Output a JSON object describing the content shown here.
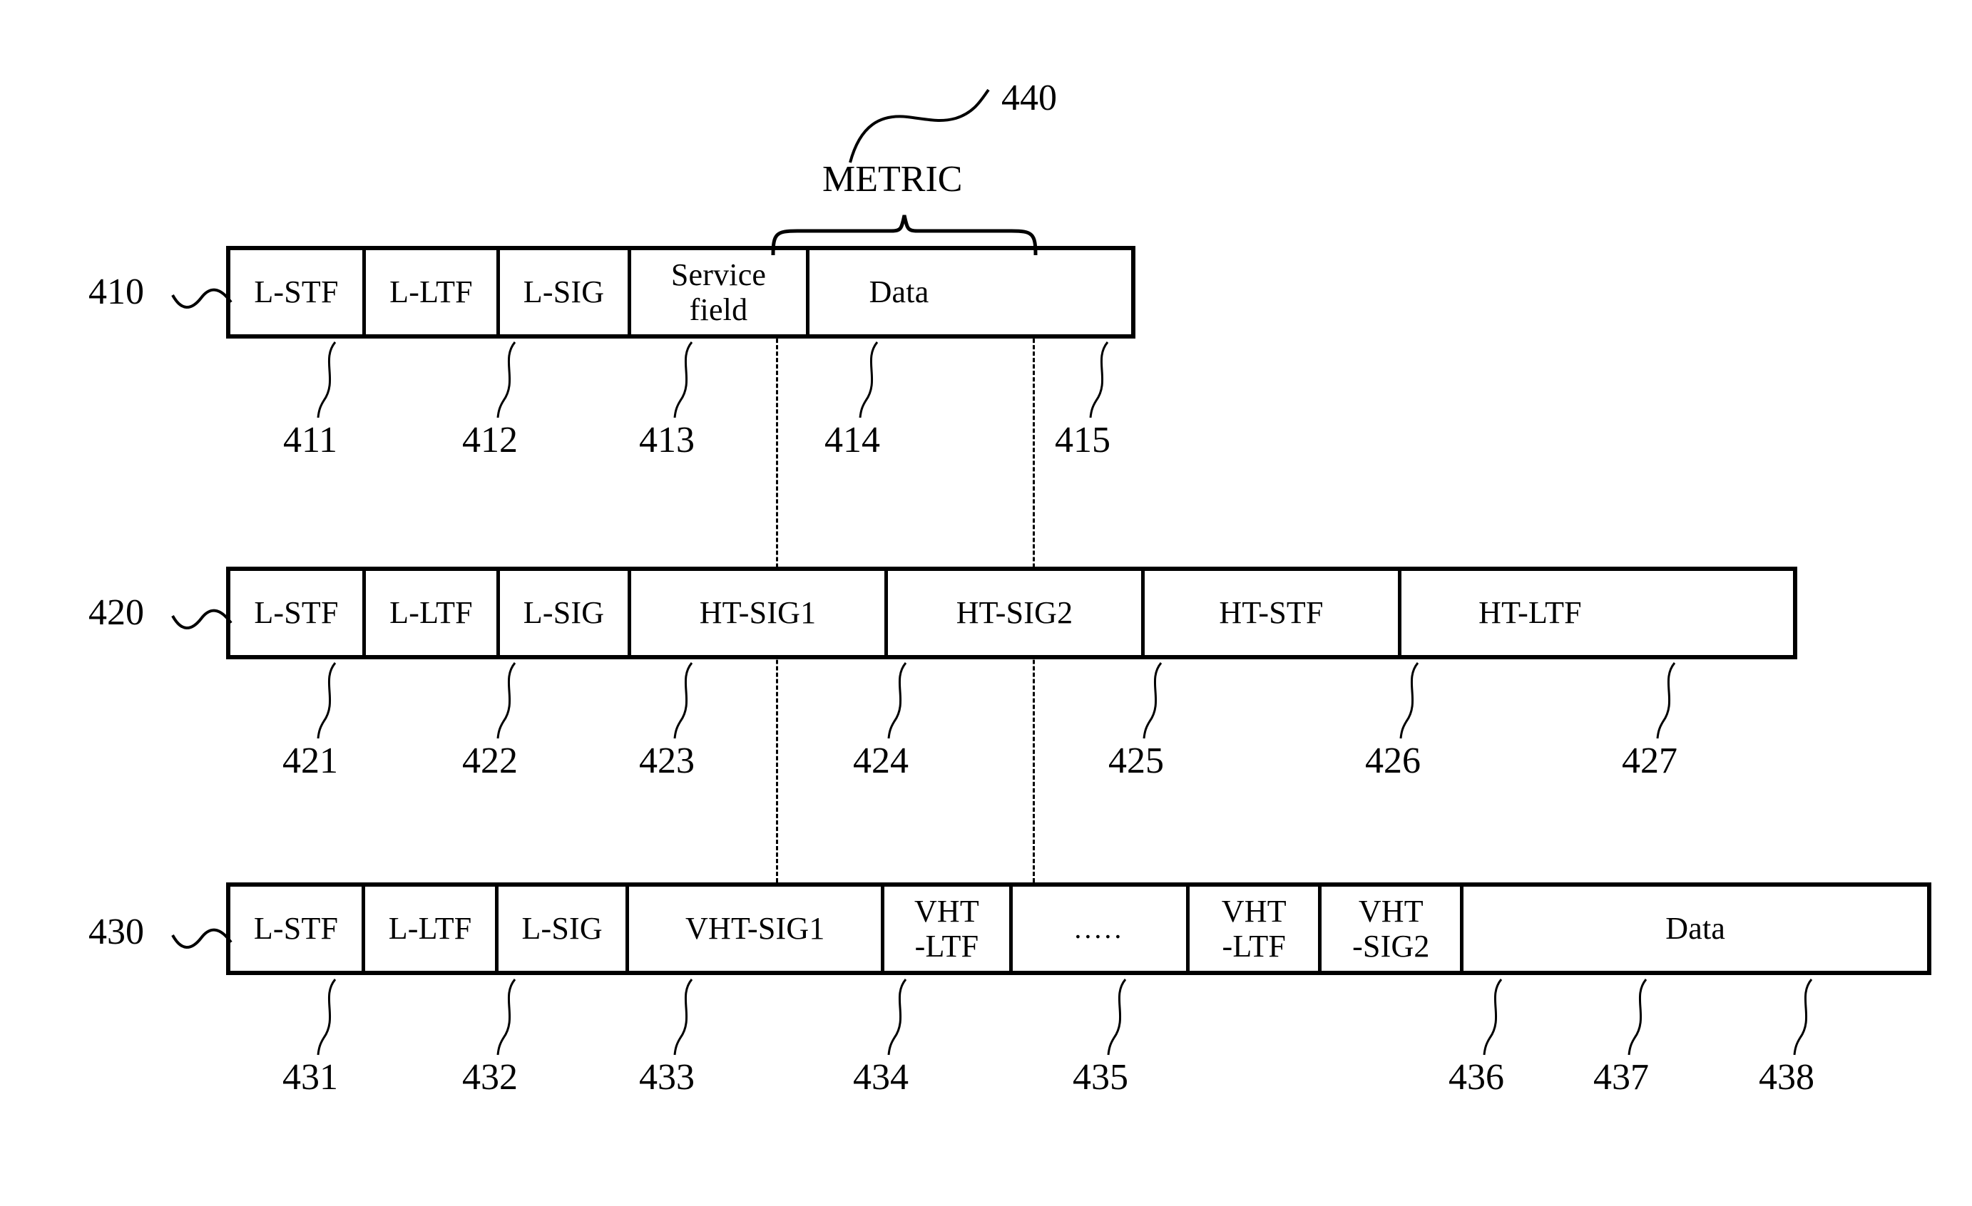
{
  "figure": {
    "metric": {
      "label": "METRIC",
      "ref": "440"
    },
    "rows": [
      {
        "ref": "410",
        "cells": [
          {
            "label": "L-STF",
            "ref": "411"
          },
          {
            "label": "L-LTF",
            "ref": "412"
          },
          {
            "label": "L-SIG",
            "ref": "413"
          },
          {
            "label": "Service\nfield",
            "ref": "414"
          },
          {
            "label": "Data",
            "ref": "415"
          }
        ]
      },
      {
        "ref": "420",
        "cells": [
          {
            "label": "L-STF",
            "ref": "421"
          },
          {
            "label": "L-LTF",
            "ref": "422"
          },
          {
            "label": "L-SIG",
            "ref": "423"
          },
          {
            "label": "HT-SIG1",
            "ref": "424"
          },
          {
            "label": "HT-SIG2",
            "ref": "425"
          },
          {
            "label": "HT-STF",
            "ref": "426"
          },
          {
            "label": "HT-LTF",
            "ref": "427"
          }
        ]
      },
      {
        "ref": "430",
        "cells": [
          {
            "label": "L-STF",
            "ref": "431"
          },
          {
            "label": "L-LTF",
            "ref": "432"
          },
          {
            "label": "L-SIG",
            "ref": "433"
          },
          {
            "label": "VHT-SIG1",
            "ref": "434"
          },
          {
            "label": "VHT\n-LTF",
            "ref": "435"
          },
          {
            "label": ".....",
            "ref": ""
          },
          {
            "label": "VHT\n-LTF",
            "ref": "436"
          },
          {
            "label": "VHT\n-SIG2",
            "ref": "437"
          },
          {
            "label": "Data",
            "ref": "438"
          }
        ]
      }
    ],
    "colors": {
      "line": "#000000",
      "background": "#ffffff"
    }
  }
}
